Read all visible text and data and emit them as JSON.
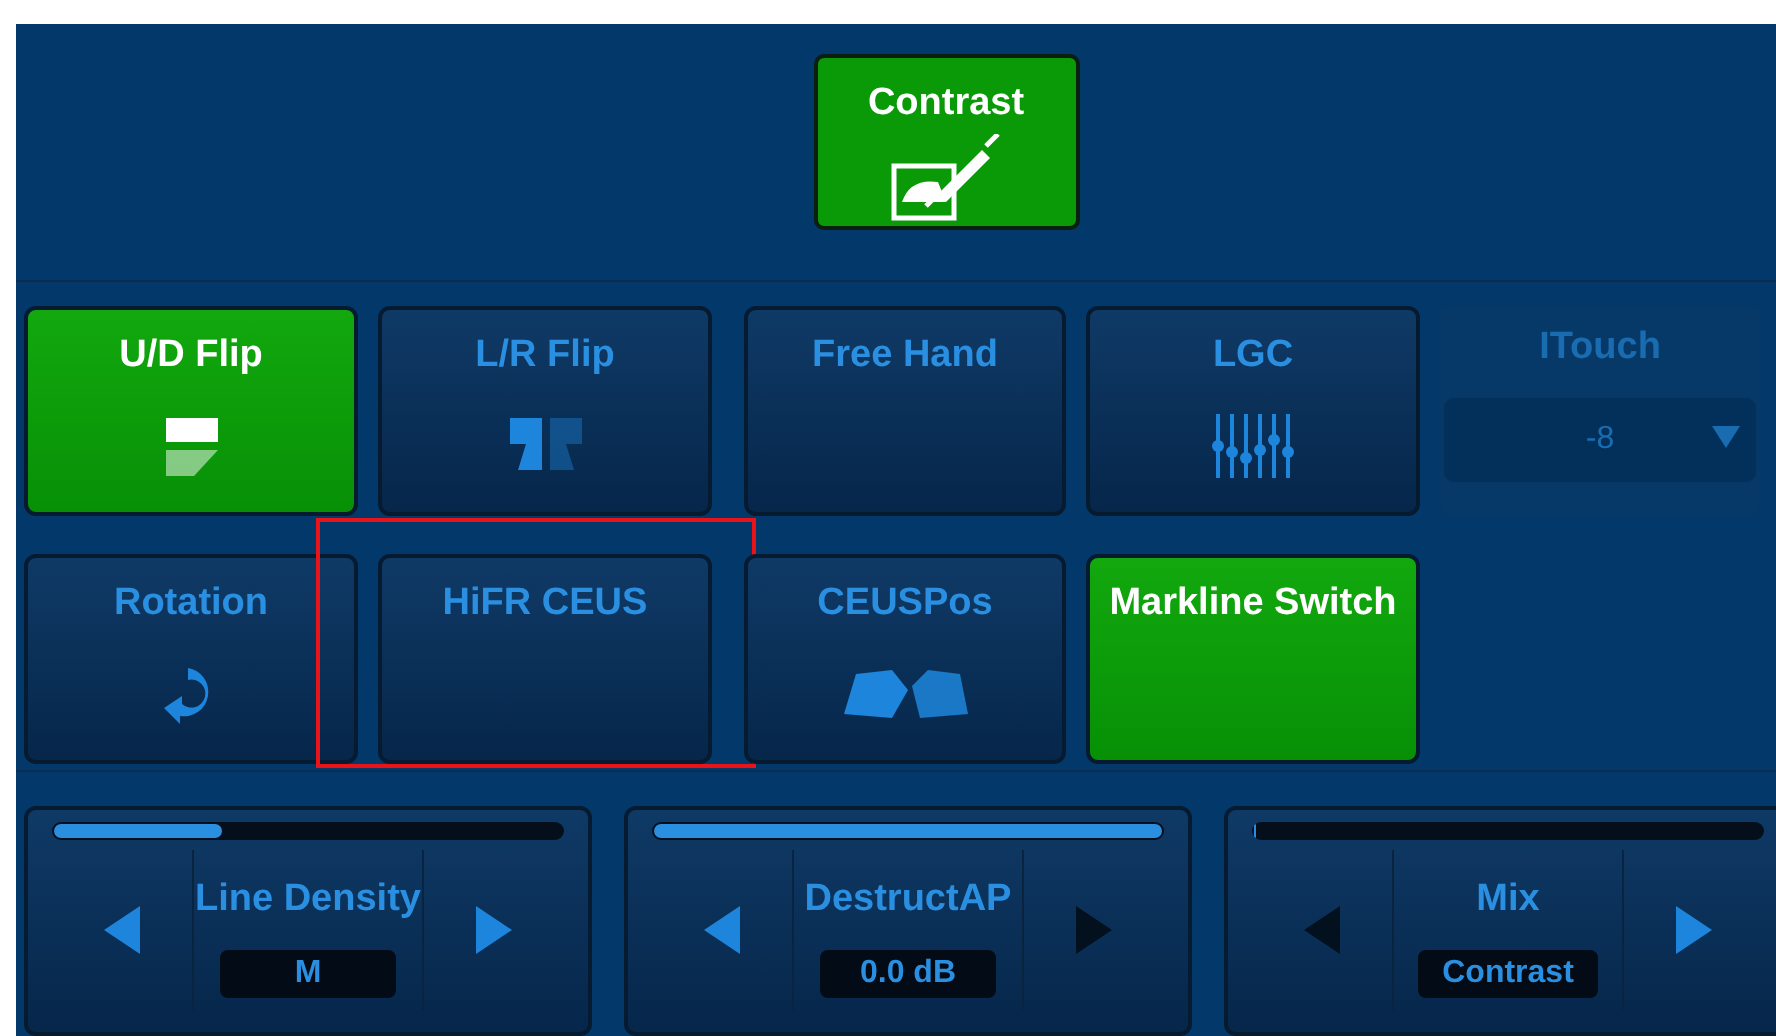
{
  "top_button": {
    "label": "Contrast",
    "selected": true
  },
  "buttons": [
    {
      "kind": "button",
      "label": "U/D Flip",
      "selected": true,
      "highlighted": false
    },
    {
      "kind": "button",
      "label": "L/R Flip",
      "selected": false,
      "highlighted": false
    },
    {
      "kind": "button",
      "label": "Free Hand",
      "selected": false,
      "highlighted": false
    },
    {
      "kind": "button",
      "label": "LGC",
      "selected": false,
      "highlighted": false
    },
    {
      "kind": "dropdown",
      "label": "ITouch",
      "value": "-8",
      "disabled": true,
      "highlighted": false
    },
    {
      "kind": "button",
      "label": "Rotation",
      "selected": false,
      "highlighted": false
    },
    {
      "kind": "button",
      "label": "HiFR  CEUS",
      "selected": false,
      "highlighted": true
    },
    {
      "kind": "button",
      "label": "CEUSPos",
      "selected": false,
      "highlighted": false
    },
    {
      "kind": "button",
      "label": "Markline Switch",
      "selected": true,
      "highlighted": false
    }
  ],
  "knobs": [
    {
      "label": "Line Density",
      "value": "M",
      "level": 0.33,
      "left_enabled": true,
      "right_enabled": true
    },
    {
      "label": "DestructAP",
      "value": "0.0 dB",
      "level": 1,
      "left_enabled": true,
      "right_enabled": false
    },
    {
      "label": "Mix",
      "value": "Contrast",
      "level": 0,
      "left_enabled": false,
      "right_enabled": true
    }
  ]
}
